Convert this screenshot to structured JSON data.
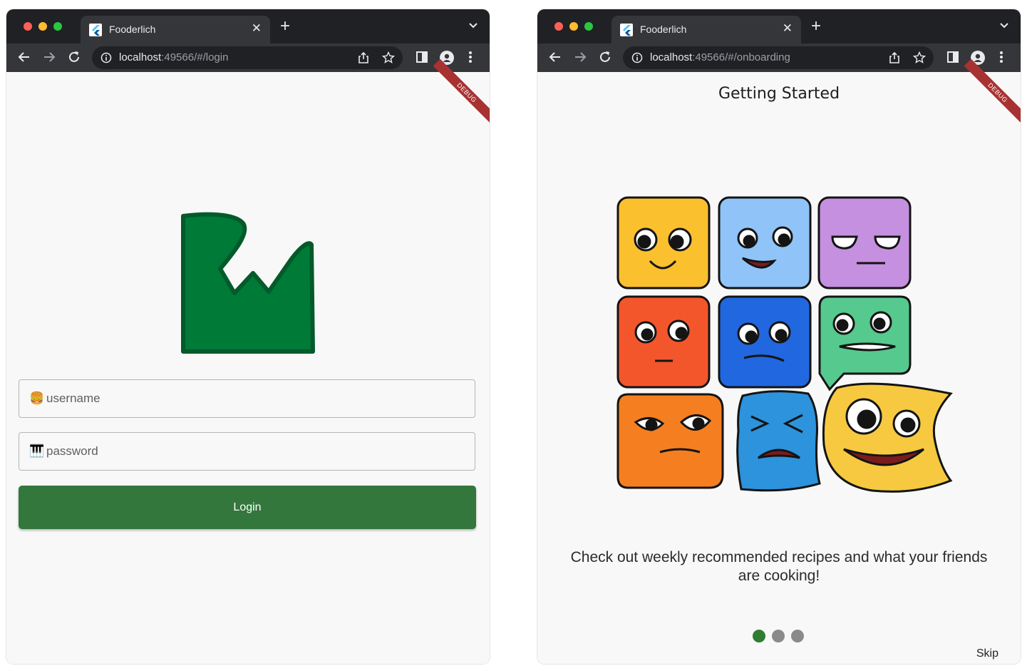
{
  "login_window": {
    "tab_title": "Fooderlich",
    "url_host": "localhost",
    "url_rest": ":49566/#/login",
    "debug_banner": "DEBUG",
    "username": {
      "icon": "🍔",
      "placeholder": "username"
    },
    "password": {
      "icon": "🎹",
      "placeholder": "password"
    },
    "login_label": "Login"
  },
  "onboarding_window": {
    "tab_title": "Fooderlich",
    "url_host": "localhost",
    "url_rest": ":49566/#/onboarding",
    "debug_banner": "DEBUG",
    "title": "Getting Started",
    "description": "Check out weekly recommended recipes and what your friends are cooking!",
    "page_dots": {
      "count": 3,
      "active_index": 0,
      "active_color": "#2e7d32",
      "inactive_color": "#8a8a8a"
    },
    "skip_label": "Skip"
  },
  "colors": {
    "login_button": "#33773c",
    "logo_green": "#007a37",
    "debug_ribbon": "#a83232",
    "browser_frame": "#202124",
    "browser_tab": "#35363a",
    "faces": [
      "#fbc02d",
      "#90c4f8",
      "#c590e0",
      "#f4562c",
      "#2167e0",
      "#56c98e",
      "#f57f20",
      "#2c93dc",
      "#f6c940"
    ]
  },
  "icons": [
    "flutter-icon",
    "close-icon",
    "new-tab-icon",
    "tab-search-icon",
    "back-icon",
    "forward-icon",
    "reload-icon",
    "site-info-icon",
    "share-icon",
    "bookmark-star-icon",
    "side-panel-icon",
    "profile-icon",
    "kebab-menu-icon"
  ]
}
